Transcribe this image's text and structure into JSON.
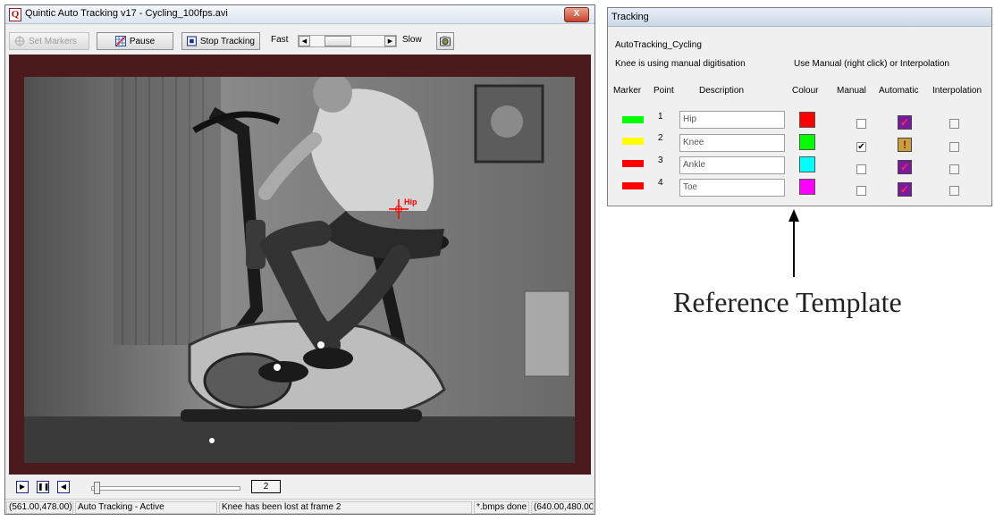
{
  "window": {
    "app_icon_letter": "Q",
    "title": "Quintic Auto Tracking v17 - Cycling_100fps.avi",
    "close_glyph": "X"
  },
  "toolbar": {
    "set_markers": "Set Markers",
    "pause": "Pause",
    "stop_tracking": "Stop Tracking",
    "fast": "Fast",
    "slow": "Slow",
    "speed_level": 0.3
  },
  "video": {
    "marker_label": "Hip",
    "marker_color": "#ff0000"
  },
  "playback": {
    "frame": "2",
    "position_fraction": 0.02
  },
  "status": {
    "cursor": "(561.00,478.00)",
    "mode": "Auto Tracking - Active",
    "message": "Knee has been lost at frame 2",
    "bmps": "*.bmps done",
    "size": "(640.00,480.00)"
  },
  "tracking": {
    "title": "Tracking",
    "name": "AutoTracking_Cycling",
    "info": "Knee is using manual digitisation",
    "hint": "Use Manual (right click)  or Interpolation",
    "headers": {
      "marker": "Marker",
      "point": "Point",
      "description": "Description",
      "colour": "Colour",
      "manual": "Manual",
      "automatic": "Automatic",
      "interpolation": "Interpolation"
    },
    "rows": [
      {
        "point": "1",
        "description": "Hip",
        "marker_color": "#00ff00",
        "colour": "#ff0000",
        "manual": false,
        "automatic": "ok"
      },
      {
        "point": "2",
        "description": "Knee",
        "marker_color": "#ffff00",
        "colour": "#00ff00",
        "manual": true,
        "automatic": "lost"
      },
      {
        "point": "3",
        "description": "Ankle",
        "marker_color": "#ff0000",
        "colour": "#00ffff",
        "manual": false,
        "automatic": "ok"
      },
      {
        "point": "4",
        "description": "Toe",
        "marker_color": "#ff0000",
        "colour": "#ff00ff",
        "manual": false,
        "automatic": "ok"
      }
    ]
  },
  "annotation": {
    "label": "Reference Template"
  }
}
